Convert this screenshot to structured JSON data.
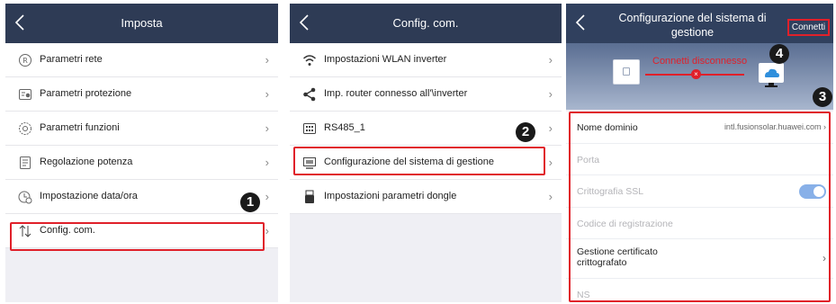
{
  "screen1": {
    "title": "Imposta",
    "items": [
      {
        "label": "Parametri rete",
        "icon": "network-params-icon"
      },
      {
        "label": "Parametri protezione",
        "icon": "protection-icon"
      },
      {
        "label": "Parametri funzioni",
        "icon": "function-gear-icon"
      },
      {
        "label": "Regolazione potenza",
        "icon": "power-doc-icon"
      },
      {
        "label": "Impostazione data/ora",
        "icon": "clock-icon"
      },
      {
        "label": "Config. com.",
        "icon": "comm-arrows-icon"
      }
    ],
    "badge": "1"
  },
  "screen2": {
    "title": "Config. com.",
    "items": [
      {
        "label": "Impostazioni WLAN inverter",
        "icon": "wifi-icon"
      },
      {
        "label": "Imp. router connesso all'\\inverter",
        "icon": "share-icon"
      },
      {
        "label": "RS485_1",
        "icon": "rs485-icon"
      },
      {
        "label": "Configurazione del sistema di gestione",
        "icon": "monitor-icon"
      },
      {
        "label": "Impostazioni parametri dongle",
        "icon": "dongle-icon"
      }
    ],
    "badge": "2"
  },
  "screen3": {
    "title": "Configurazione del sistema di gestione",
    "connect_button": "Connetti",
    "status_text": "Connetti disconnesso",
    "badge3": "3",
    "badge4": "4",
    "fields": {
      "domain_label": "Nome dominio",
      "domain_value": "intl.fusionsolar.huawei.com",
      "port_label": "Porta",
      "ssl_label": "Crittografia SSL",
      "ssl_enabled": true,
      "regcode_label": "Codice di registrazione",
      "cert_label_1": "Gestione certificato",
      "cert_label_2": "crittografato",
      "ns_label": "NS"
    }
  },
  "colors": {
    "header": "#2e3b55",
    "highlight": "#e0202a",
    "background": "#efeff4",
    "toggle": "#88b0e8"
  }
}
